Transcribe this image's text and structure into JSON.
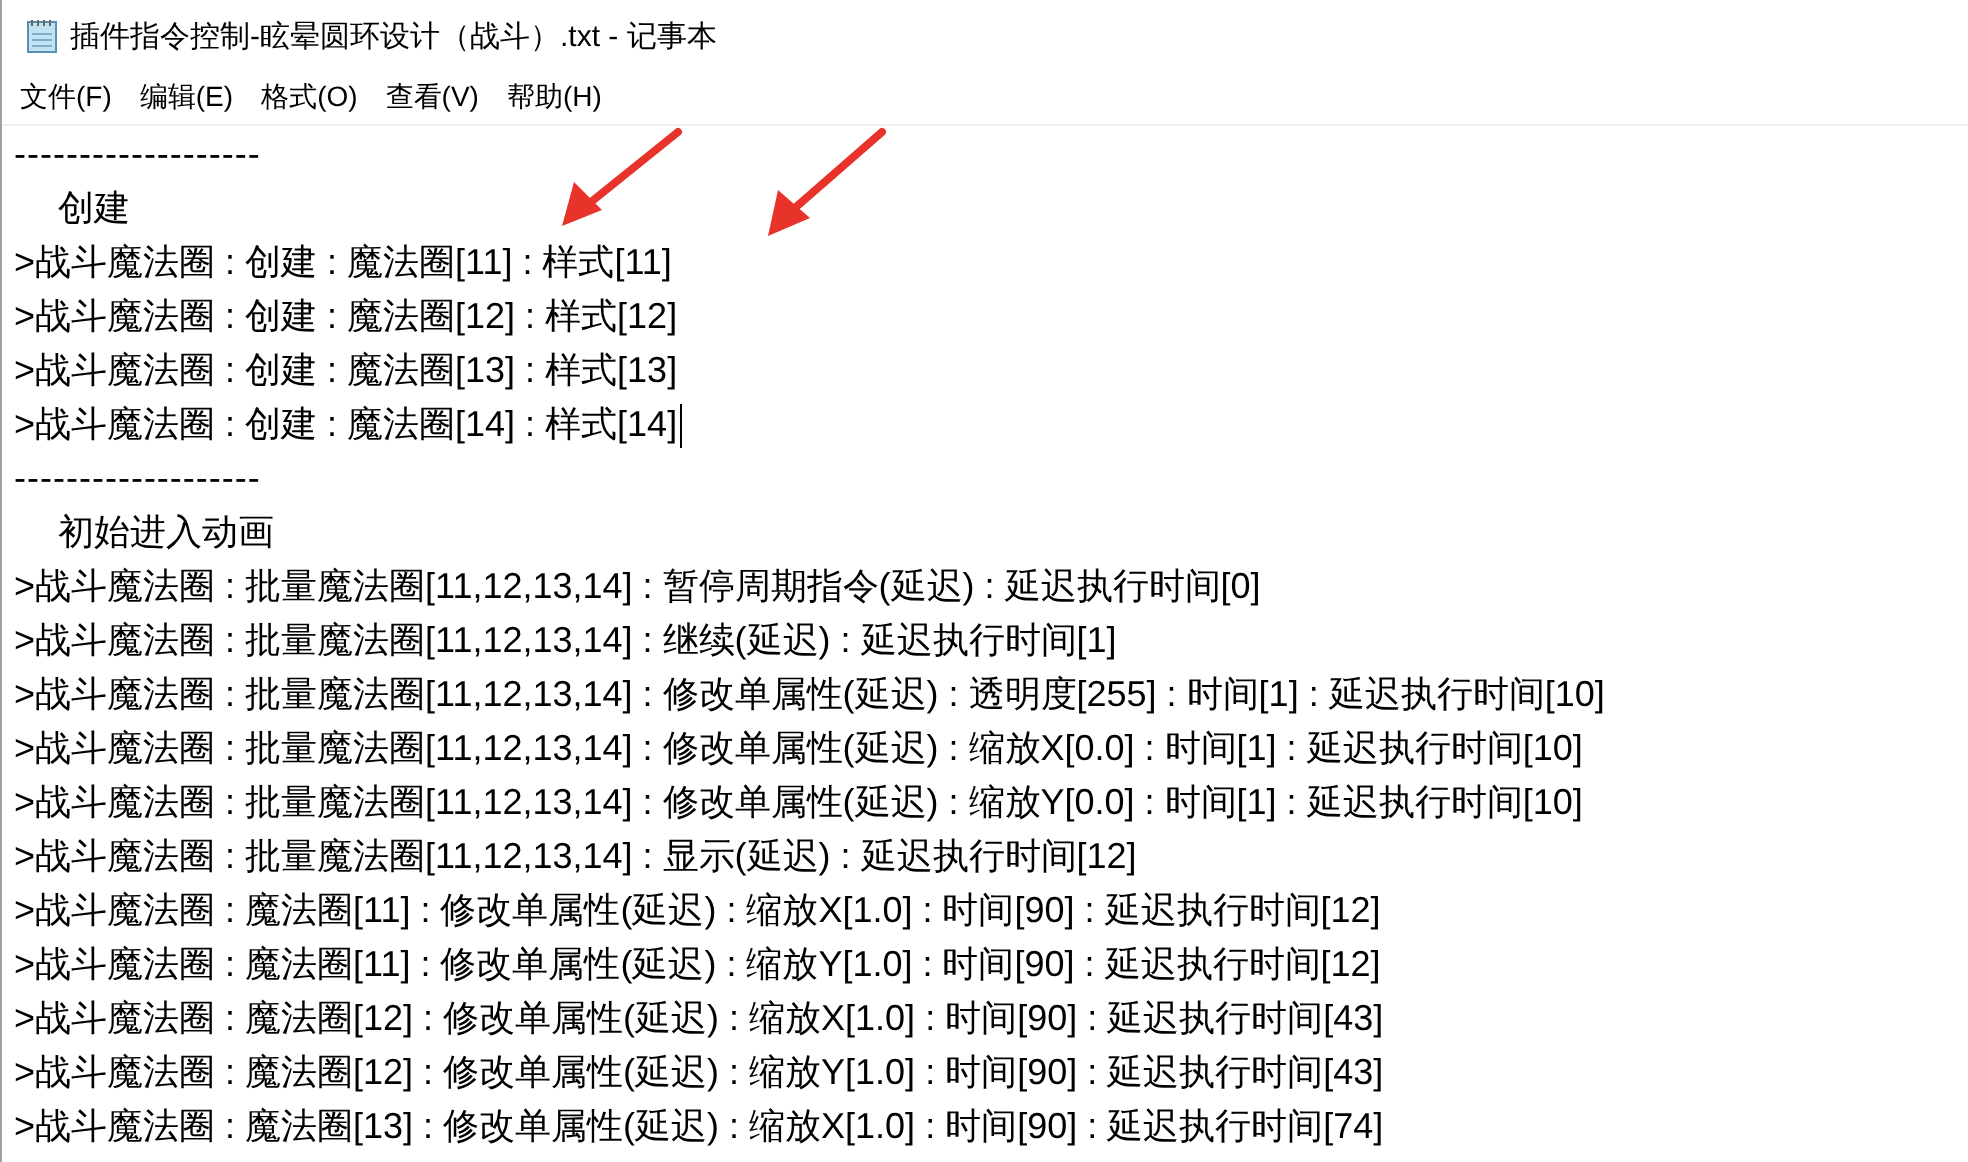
{
  "window": {
    "title": "插件指令控制-眩晕圆环设计（战斗）.txt - 记事本"
  },
  "menu": [
    "文件(F)",
    "编辑(E)",
    "格式(O)",
    "查看(V)",
    "帮助(H)"
  ],
  "lines": [
    {
      "kind": "separator",
      "text": "-------------------"
    },
    {
      "kind": "heading",
      "text": "创建"
    },
    {
      "kind": "command",
      "text": ">战斗魔法圈 : 创建 : 魔法圈[11] : 样式[11]"
    },
    {
      "kind": "command",
      "text": ">战斗魔法圈 : 创建 : 魔法圈[12] : 样式[12]"
    },
    {
      "kind": "command",
      "text": ">战斗魔法圈 : 创建 : 魔法圈[13] : 样式[13]"
    },
    {
      "kind": "command",
      "text": ">战斗魔法圈 : 创建 : 魔法圈[14] : 样式[14]",
      "cursor": true
    },
    {
      "kind": "separator",
      "text": "-------------------"
    },
    {
      "kind": "heading",
      "text": "初始进入动画"
    },
    {
      "kind": "command",
      "text": ">战斗魔法圈 : 批量魔法圈[11,12,13,14] : 暂停周期指令(延迟) : 延迟执行时间[0]"
    },
    {
      "kind": "command",
      "text": ">战斗魔法圈 : 批量魔法圈[11,12,13,14] : 继续(延迟) : 延迟执行时间[1]"
    },
    {
      "kind": "command",
      "text": ">战斗魔法圈 : 批量魔法圈[11,12,13,14] : 修改单属性(延迟) : 透明度[255] : 时间[1] : 延迟执行时间[10]"
    },
    {
      "kind": "command",
      "text": ">战斗魔法圈 : 批量魔法圈[11,12,13,14] : 修改单属性(延迟) : 缩放X[0.0] : 时间[1] : 延迟执行时间[10]"
    },
    {
      "kind": "command",
      "text": ">战斗魔法圈 : 批量魔法圈[11,12,13,14] : 修改单属性(延迟) : 缩放Y[0.0] : 时间[1] : 延迟执行时间[10]"
    },
    {
      "kind": "command",
      "text": ">战斗魔法圈 : 批量魔法圈[11,12,13,14] : 显示(延迟) : 延迟执行时间[12]"
    },
    {
      "kind": "command",
      "text": ">战斗魔法圈 : 魔法圈[11] : 修改单属性(延迟) : 缩放X[1.0] : 时间[90] : 延迟执行时间[12]"
    },
    {
      "kind": "command",
      "text": ">战斗魔法圈 : 魔法圈[11] : 修改单属性(延迟) : 缩放Y[1.0] : 时间[90] : 延迟执行时间[12]"
    },
    {
      "kind": "command",
      "text": ">战斗魔法圈 : 魔法圈[12] : 修改单属性(延迟) : 缩放X[1.0] : 时间[90] : 延迟执行时间[43]"
    },
    {
      "kind": "command",
      "text": ">战斗魔法圈 : 魔法圈[12] : 修改单属性(延迟) : 缩放Y[1.0] : 时间[90] : 延迟执行时间[43]"
    },
    {
      "kind": "command",
      "text": ">战斗魔法圈 : 魔法圈[13] : 修改单属性(延迟) : 缩放X[1.0] : 时间[90] : 延迟执行时间[74]"
    }
  ]
}
